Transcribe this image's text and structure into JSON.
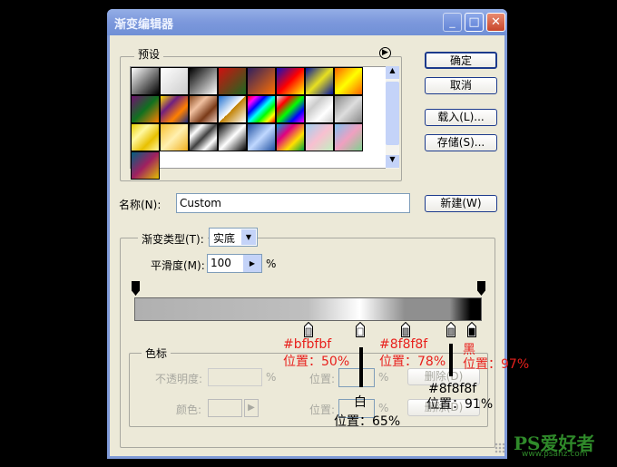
{
  "window": {
    "title": "渐变编辑器",
    "minimize": "_",
    "maximize": "□",
    "close": "✕"
  },
  "presets": {
    "label": "预设",
    "menu_icon": "▶",
    "swatches": [
      "linear-gradient(135deg,#fff,#000)",
      "linear-gradient(135deg,#fff,#ccc)",
      "linear-gradient(135deg,#000,#fff)",
      "linear-gradient(135deg,#d01010,#1a6a20)",
      "linear-gradient(135deg,#302060,#ff7000)",
      "linear-gradient(135deg,#1010c0,#ff0000,#ffff00)",
      "linear-gradient(135deg,#0010a0,#e8e020,#0010a0)",
      "linear-gradient(135deg,#ff6000,#ffff00,#ff6000)",
      "linear-gradient(135deg,#701070,#107020,#ff8000)",
      "linear-gradient(135deg,#ffe000,#702080,#ff8000,#203080)",
      "linear-gradient(135deg,#8a4a20,#f0c0a0,#7a3a18,#f0d0c0)",
      "linear-gradient(135deg,#2070d0,#fff 50%,#c08000 50%,#fff)",
      "linear-gradient(135deg,#ff0000,#ff00ff,#0000ff,#00ffff,#00ff00,#ffff00,#ff0000)",
      "linear-gradient(135deg,#ddd,#ff0000,#00ff00,#0000ff,#ff00ff)",
      "linear-gradient(135deg,#fff,#ccc,#fff,#ccc)",
      "linear-gradient(135deg,#888,#ddd,#888)",
      "linear-gradient(135deg,#e8d000,#fff8a0,#e8c000,#fff8a0)",
      "linear-gradient(135deg,#f8c030,#fff0b0,#f0b020)",
      "linear-gradient(135deg,#404040,#fff,#404040,#fff,#404040)",
      "linear-gradient(135deg,#000,#fff,#000)",
      "linear-gradient(135deg,#2050a0,#c0d8ff,#2050a0)",
      "linear-gradient(135deg,#00a0e0,#e00080,#ffe000,#00a040)",
      "linear-gradient(135deg,#a0d0f0,#f8c0d0,#c0f0c0)",
      "linear-gradient(135deg,#80c0f0,#f0a0c0,#80d090)",
      "linear-gradient(135deg,#006080,#a02060,#e0c000)"
    ]
  },
  "buttons": {
    "ok": "确定",
    "cancel": "取消",
    "load": "载入(L)...",
    "save": "存储(S)...",
    "new": "新建(W)"
  },
  "name": {
    "label": "名称(N):",
    "value": "Custom"
  },
  "gradient": {
    "type_label": "渐变类型(T):",
    "type_value": "实底",
    "smooth_label": "平滑度(M):",
    "smooth_value": "100",
    "percent": "%",
    "stops": [
      {
        "color": "#b0b0b0",
        "pos": 0
      },
      {
        "color": "#bfbfbf",
        "pos": 50
      },
      {
        "color": "#ffffff",
        "pos": 65
      },
      {
        "color": "#8f8f8f",
        "pos": 78
      },
      {
        "color": "#8f8f8f",
        "pos": 91
      },
      {
        "color": "#000000",
        "pos": 97
      }
    ]
  },
  "stops_group": {
    "label": "色标",
    "opacity_label": "不透明度:",
    "color_label": "颜色:",
    "location_label": "位置:",
    "percent": "%",
    "delete": "删除(D)"
  },
  "annotations": {
    "a1_color": "#bfbfbf",
    "a1_pos": "位置：50%",
    "a2_color": "白",
    "a2_pos": "位置：65%",
    "a3_color": "#8f8f8f",
    "a3_pos": "位置：78%",
    "a4_color": "#8f8f8f",
    "a4_pos": "位置：91%",
    "a5_color": "黑",
    "a5_pos": "位置：97%"
  },
  "watermark": {
    "text": "PS爱好者",
    "url": "www.psahz.com"
  }
}
